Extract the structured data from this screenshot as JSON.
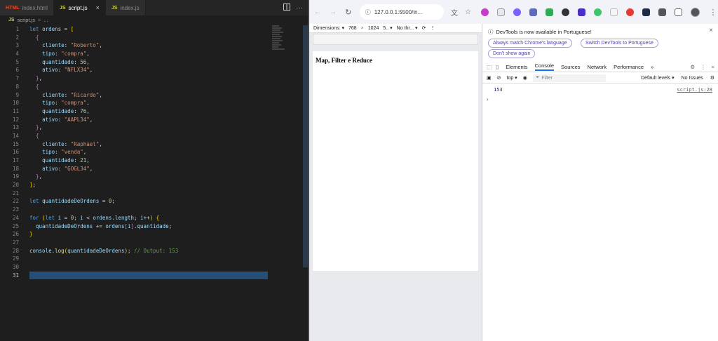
{
  "editor": {
    "tabs": [
      {
        "lang": "HTML",
        "label": "index.html",
        "active": false
      },
      {
        "lang": "JS",
        "label": "script.js",
        "active": true,
        "close": "×"
      },
      {
        "lang": "JS",
        "label": "index.js",
        "active": false
      }
    ],
    "breadcrumb": {
      "lang": "JS",
      "file": "script.js",
      "sep": ">",
      "tail": "..."
    },
    "current_line": 31,
    "lines": [
      "let ordens = [",
      "  {",
      "    cliente: \"Roberto\",",
      "    tipo: \"compra\",",
      "    quantidade: 56,",
      "    ativo: \"NFLX34\",",
      "  },",
      "  {",
      "    cliente: \"Ricardo\",",
      "    tipo: \"compra\",",
      "    quantidade: 76,",
      "    ativo: \"AAPL34\",",
      "  },",
      "  {",
      "    cliente: \"Raphael\",",
      "    tipo: \"venda\",",
      "    quantidade: 21,",
      "    ativo: \"GOGL34\",",
      "  },",
      "];",
      "",
      "let quantidadeDeOrdens = 0;",
      "",
      "for (let i = 0; i < ordens.length; i++) {",
      "  quantidadeDeOrdens += ordens[i].quantidade;",
      "}",
      "",
      "console.log(quantidadeDeOrdens); // Output: 153",
      "",
      "",
      ""
    ]
  },
  "browser": {
    "url": "127.0.0.1:5500/in...",
    "device_toolbar": {
      "mode": "Dimensions: ▾",
      "width": "768",
      "x": "×",
      "height": "1024",
      "zoom": "5.. ▾",
      "throttle": "No thr... ▾"
    },
    "page_title": "Map, Filter e Reduce"
  },
  "devtools": {
    "banner_text": "DevTools is now available in Portuguese!",
    "btn_match": "Always match Chrome's language",
    "btn_switch": "Switch DevTools to Portuguese",
    "btn_dont_show": "Don't show again",
    "tabs": [
      "Elements",
      "Console",
      "Sources",
      "Network",
      "Performance"
    ],
    "active_tab": "Console",
    "context": "top ▾",
    "filter_placeholder": "Filter",
    "levels": "Default levels ▾",
    "issues": "No Issues",
    "log_value": "153",
    "log_source": "script.js:28",
    "prompt": "›"
  }
}
